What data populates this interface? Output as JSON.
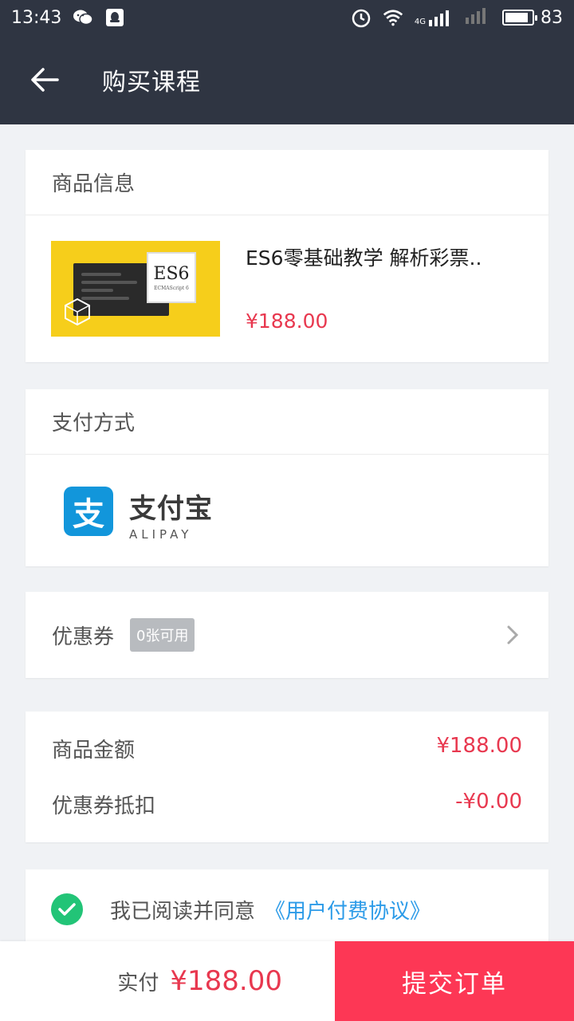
{
  "status_bar": {
    "time": "13:43",
    "battery": "83",
    "network": "4G",
    "icons": [
      "wechat-icon",
      "qq-icon",
      "alarm-icon",
      "wifi-icon",
      "signal-icon",
      "signal-empty-icon",
      "battery-icon"
    ]
  },
  "header": {
    "title": "购买课程",
    "back_icon": "arrow-left-icon"
  },
  "product": {
    "section_title": "商品信息",
    "name": "ES6零基础教学 解析彩票..",
    "price": "¥188.00",
    "thumb_badge": "ES6",
    "thumb_sub": "ECMAScript 6"
  },
  "payment": {
    "section_title": "支付方式",
    "method_cn": "支付宝",
    "method_en": "ALIPAY",
    "logo_char": "支"
  },
  "coupon": {
    "label": "优惠券",
    "badge": "0张可用"
  },
  "amounts": {
    "subtotal_label": "商品金额",
    "subtotal_value": "¥188.00",
    "discount_label": "优惠券抵扣",
    "discount_value": "-¥0.00"
  },
  "agreement": {
    "text": "我已阅读并同意",
    "link": "《用户付费协议》",
    "checked": true
  },
  "footer": {
    "pay_label": "实付",
    "pay_value": "¥188.00",
    "submit_label": "提交订单"
  },
  "colors": {
    "header_bg": "#2f3542",
    "price_red": "#e8384f",
    "submit_bg": "#fd3755",
    "check_green": "#22c477",
    "link_blue": "#2c9be8",
    "alipay_blue": "#1296db"
  }
}
